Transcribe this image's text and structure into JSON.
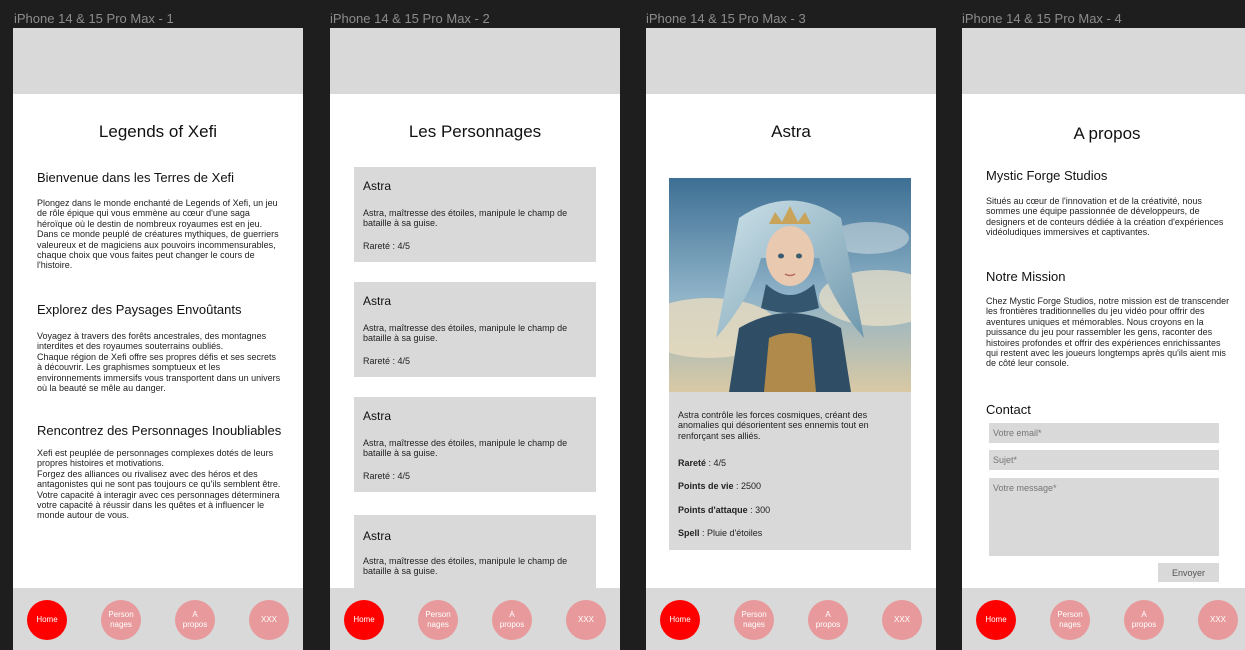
{
  "frames": [
    {
      "label": "iPhone 14 & 15 Pro Max - 1"
    },
    {
      "label": "iPhone 14 & 15 Pro Max - 2"
    },
    {
      "label": "iPhone 14 & 15 Pro Max - 3"
    },
    {
      "label": "iPhone 14 & 15 Pro Max - 4"
    }
  ],
  "nav": {
    "home": "Home",
    "personnages": "Person\nnages",
    "apropos": "A\npropos",
    "xxx": "XXX",
    "active_color": "#ff0000",
    "inactive_color": "#e8999b"
  },
  "home": {
    "title": "Legends of Xefi",
    "sections": [
      {
        "heading": "Bienvenue dans les Terres de Xefi",
        "text": "Plongez dans le monde enchanté de Legends of Xefi, un jeu de rôle épique qui vous emmène au cœur d'une saga héroïque où le destin de nombreux royaumes est en jeu.\nDans ce monde peuplé de créatures mythiques, de guerriers valeureux et de magiciens aux pouvoirs incommensurables, chaque choix que vous faites peut changer le cours de l'histoire."
      },
      {
        "heading": "Explorez des Paysages Envoûtants",
        "text": "Voyagez à travers des forêts ancestrales, des montagnes interdites et des royaumes souterrains oubliés.\nChaque région de Xefi offre ses propres défis et ses secrets à découvrir. Les graphismes somptueux et les environnements immersifs vous transportent dans un univers où la beauté se mêle au danger."
      },
      {
        "heading": "Rencontrez des Personnages Inoubliables",
        "text": "Xefi est peuplée de personnages complexes dotés de leurs propres histoires et motivations.\nForgez des alliances ou rivalisez avec des héros et des antagonistes qui ne sont pas toujours ce qu'ils semblent être.\nVotre capacité à interagir avec ces personnages déterminera votre capacité à réussir dans les quêtes et à influencer le monde autour de vous."
      }
    ]
  },
  "characters": {
    "title": "Les Personnages",
    "cards": [
      {
        "name": "Astra",
        "description": "Astra, maîtresse des étoiles, manipule le champ de bataille à sa guise.",
        "rarity": "Rareté : 4/5"
      },
      {
        "name": "Astra",
        "description": "Astra, maîtresse des étoiles, manipule le champ de bataille à sa guise.",
        "rarity": "Rareté : 4/5"
      },
      {
        "name": "Astra",
        "description": "Astra, maîtresse des étoiles, manipule le champ de bataille à sa guise.",
        "rarity": "Rareté : 4/5"
      },
      {
        "name": "Astra",
        "description": "Astra, maîtresse des étoiles, manipule le champ de bataille à sa guise.",
        "rarity": ""
      }
    ]
  },
  "detail": {
    "title": "Astra",
    "description": "Astra contrôle les forces cosmiques, créant des anomalies qui désorientent ses ennemis tout en renforçant ses alliés.",
    "stats": [
      {
        "label": "Rareté",
        "value": " : 4/5"
      },
      {
        "label": "Points de vie",
        "value": " : 2500"
      },
      {
        "label": "Points d'attaque",
        "value": " : 300"
      },
      {
        "label": "Spell",
        "value": " : Pluie d'étoiles"
      }
    ]
  },
  "about": {
    "title": "A propos",
    "studio_heading": "Mystic Forge Studios",
    "studio_text": "Situés au cœur de l'innovation et de la créativité, nous sommes une équipe passionnée de développeurs, de designers et de conteurs dédiée à la création d'expériences vidéoludiques immersives et captivantes.",
    "mission_heading": "Notre Mission",
    "mission_text": "Chez Mystic Forge Studios, notre mission est de transcender les frontières traditionnelles du jeu vidéo pour offrir des aventures uniques et mémorables. Nous croyons en la puissance du jeu pour rassembler les gens, raconter des histoires profondes et offrir des expériences enrichissantes qui restent avec les joueurs longtemps après qu'ils aient mis de côté leur console.",
    "contact_heading": "Contact",
    "email_placeholder": "Votre email*",
    "subject_placeholder": "Sujet*",
    "message_placeholder": "Votre message*",
    "send_label": "Envoyer"
  }
}
